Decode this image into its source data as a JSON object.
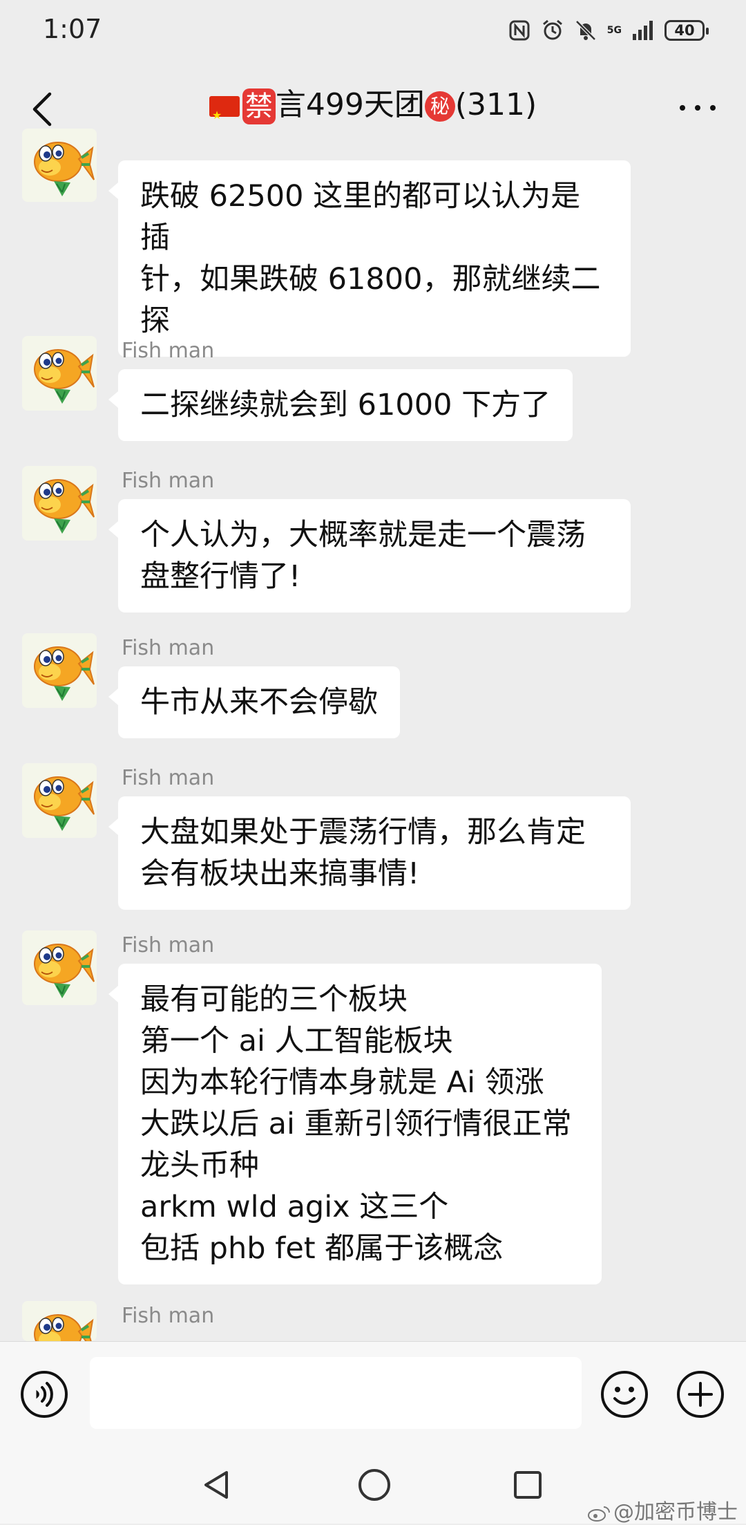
{
  "status_bar": {
    "time": "1:07",
    "network": "5G",
    "battery": "40"
  },
  "header": {
    "title": "言499天团",
    "ban_badge": "禁",
    "secret_badge": "秘",
    "member_count": "(311)"
  },
  "messages": [
    {
      "sender": "",
      "text": "跌破 62500 这里的都可以认为是插\n针，如果跌破 61800，那就继续二\n探"
    },
    {
      "sender": "Fish man",
      "text": "二探继续就会到 61000 下方了"
    },
    {
      "sender": "Fish man",
      "text": "个人认为，大概率就是走一个震荡\n盘整行情了!"
    },
    {
      "sender": "Fish man",
      "text": "牛市从来不会停歇"
    },
    {
      "sender": "Fish man",
      "text": "大盘如果处于震荡行情，那么肯定\n会有板块出来搞事情!"
    },
    {
      "sender": "Fish man",
      "text": "最有可能的三个板块\n第一个 ai 人工智能板块\n因为本轮行情本身就是 Ai 领涨\n大跌以后 ai 重新引领行情很正常\n龙头币种\narkm wld agix 这三个\n包括 phb fet 都属于该概念"
    },
    {
      "sender": "Fish man",
      "text": ""
    }
  ],
  "input_bar": {
    "placeholder": ""
  },
  "watermark": "@加密币博士",
  "icons": {
    "back": "back-arrow-icon",
    "more": "more-icon",
    "voice": "voice-icon",
    "emoji": "emoji-icon",
    "plus": "plus-icon",
    "nav_back": "nav-back-icon",
    "nav_home": "nav-home-icon",
    "nav_recent": "nav-recent-icon"
  },
  "colors": {
    "background": "#ededed",
    "bubble": "#ffffff",
    "sender": "#8a8a8a",
    "badge_red": "#e53935"
  }
}
